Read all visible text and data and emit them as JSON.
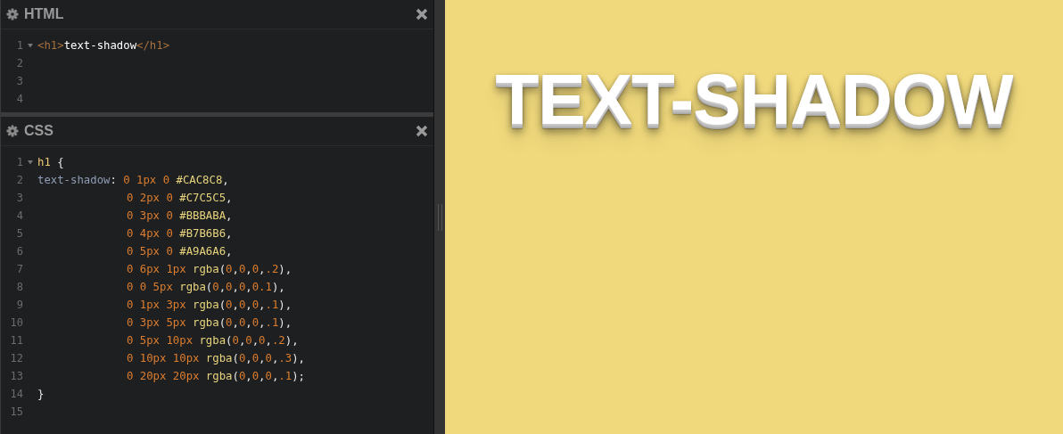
{
  "editors": [
    {
      "title": "HTML",
      "lines": [
        {
          "number": "1",
          "foldable": true,
          "indented": false,
          "tokens": [
            {
              "kind": "tag",
              "text": "<h1>"
            },
            {
              "kind": "text",
              "text": "text-shadow"
            },
            {
              "kind": "tag",
              "text": "</h1>"
            }
          ]
        },
        {
          "number": "2",
          "foldable": false
        },
        {
          "number": "3",
          "foldable": false
        },
        {
          "number": "4",
          "foldable": false
        }
      ]
    },
    {
      "title": "CSS",
      "lines": [
        {
          "number": "1",
          "foldable": true,
          "indented": false,
          "tokens": [
            {
              "kind": "selector",
              "text": "h1"
            },
            {
              "kind": "punct",
              "text": " {"
            }
          ]
        },
        {
          "number": "2",
          "foldable": false,
          "indented": false,
          "tokens": [
            {
              "kind": "property",
              "text": "text-shadow"
            },
            {
              "kind": "punct",
              "text": ": "
            },
            {
              "kind": "number",
              "text": "0 1px 0"
            },
            {
              "kind": "value",
              "text": " #CAC8C8"
            },
            {
              "kind": "punct",
              "text": ","
            }
          ]
        },
        {
          "number": "3",
          "foldable": false,
          "indented": true,
          "tokens": [
            {
              "kind": "number",
              "text": "0 2px 0"
            },
            {
              "kind": "value",
              "text": " #C7C5C5"
            },
            {
              "kind": "punct",
              "text": ","
            }
          ]
        },
        {
          "number": "4",
          "foldable": false,
          "indented": true,
          "tokens": [
            {
              "kind": "number",
              "text": "0 3px 0"
            },
            {
              "kind": "value",
              "text": " #BBBABA"
            },
            {
              "kind": "punct",
              "text": ","
            }
          ]
        },
        {
          "number": "5",
          "foldable": false,
          "indented": true,
          "tokens": [
            {
              "kind": "number",
              "text": "0 4px 0"
            },
            {
              "kind": "value",
              "text": " #B7B6B6"
            },
            {
              "kind": "punct",
              "text": ","
            }
          ]
        },
        {
          "number": "6",
          "foldable": false,
          "indented": true,
          "tokens": [
            {
              "kind": "number",
              "text": "0 5px 0"
            },
            {
              "kind": "value",
              "text": " #A9A6A6"
            },
            {
              "kind": "punct",
              "text": ","
            }
          ]
        },
        {
          "number": "7",
          "foldable": false,
          "indented": true,
          "tokens": [
            {
              "kind": "number",
              "text": "0 6px 1px"
            },
            {
              "kind": "value",
              "text": " rgba"
            },
            {
              "kind": "punct",
              "text": "("
            },
            {
              "kind": "number",
              "text": "0"
            },
            {
              "kind": "punct",
              "text": ","
            },
            {
              "kind": "number",
              "text": "0"
            },
            {
              "kind": "punct",
              "text": ","
            },
            {
              "kind": "number",
              "text": "0"
            },
            {
              "kind": "punct",
              "text": ","
            },
            {
              "kind": "number",
              "text": ".2"
            },
            {
              "kind": "punct",
              "text": "),"
            }
          ]
        },
        {
          "number": "8",
          "foldable": false,
          "indented": true,
          "tokens": [
            {
              "kind": "number",
              "text": "0 0 5px"
            },
            {
              "kind": "value",
              "text": " rgba"
            },
            {
              "kind": "punct",
              "text": "("
            },
            {
              "kind": "number",
              "text": "0"
            },
            {
              "kind": "punct",
              "text": ","
            },
            {
              "kind": "number",
              "text": "0"
            },
            {
              "kind": "punct",
              "text": ","
            },
            {
              "kind": "number",
              "text": "0"
            },
            {
              "kind": "punct",
              "text": ","
            },
            {
              "kind": "number",
              "text": "0.1"
            },
            {
              "kind": "punct",
              "text": "),"
            }
          ]
        },
        {
          "number": "9",
          "foldable": false,
          "indented": true,
          "tokens": [
            {
              "kind": "number",
              "text": "0 1px 3px"
            },
            {
              "kind": "value",
              "text": " rgba"
            },
            {
              "kind": "punct",
              "text": "("
            },
            {
              "kind": "number",
              "text": "0"
            },
            {
              "kind": "punct",
              "text": ","
            },
            {
              "kind": "number",
              "text": "0"
            },
            {
              "kind": "punct",
              "text": ","
            },
            {
              "kind": "number",
              "text": "0"
            },
            {
              "kind": "punct",
              "text": ","
            },
            {
              "kind": "number",
              "text": ".1"
            },
            {
              "kind": "punct",
              "text": "),"
            }
          ]
        },
        {
          "number": "10",
          "foldable": false,
          "indented": true,
          "tokens": [
            {
              "kind": "number",
              "text": "0 3px 5px"
            },
            {
              "kind": "value",
              "text": " rgba"
            },
            {
              "kind": "punct",
              "text": "("
            },
            {
              "kind": "number",
              "text": "0"
            },
            {
              "kind": "punct",
              "text": ","
            },
            {
              "kind": "number",
              "text": "0"
            },
            {
              "kind": "punct",
              "text": ","
            },
            {
              "kind": "number",
              "text": "0"
            },
            {
              "kind": "punct",
              "text": ","
            },
            {
              "kind": "number",
              "text": ".1"
            },
            {
              "kind": "punct",
              "text": "),"
            }
          ]
        },
        {
          "number": "11",
          "foldable": false,
          "indented": true,
          "tokens": [
            {
              "kind": "number",
              "text": "0 5px 10px"
            },
            {
              "kind": "value",
              "text": " rgba"
            },
            {
              "kind": "punct",
              "text": "("
            },
            {
              "kind": "number",
              "text": "0"
            },
            {
              "kind": "punct",
              "text": ","
            },
            {
              "kind": "number",
              "text": "0"
            },
            {
              "kind": "punct",
              "text": ","
            },
            {
              "kind": "number",
              "text": "0"
            },
            {
              "kind": "punct",
              "text": ","
            },
            {
              "kind": "number",
              "text": ".2"
            },
            {
              "kind": "punct",
              "text": "),"
            }
          ]
        },
        {
          "number": "12",
          "foldable": false,
          "indented": true,
          "tokens": [
            {
              "kind": "number",
              "text": "0 10px 10px"
            },
            {
              "kind": "value",
              "text": " rgba"
            },
            {
              "kind": "punct",
              "text": "("
            },
            {
              "kind": "number",
              "text": "0"
            },
            {
              "kind": "punct",
              "text": ","
            },
            {
              "kind": "number",
              "text": "0"
            },
            {
              "kind": "punct",
              "text": ","
            },
            {
              "kind": "number",
              "text": "0"
            },
            {
              "kind": "punct",
              "text": ","
            },
            {
              "kind": "number",
              "text": ".3"
            },
            {
              "kind": "punct",
              "text": "),"
            }
          ]
        },
        {
          "number": "13",
          "foldable": false,
          "indented": true,
          "tokens": [
            {
              "kind": "number",
              "text": "0 20px 20px"
            },
            {
              "kind": "value",
              "text": " rgba"
            },
            {
              "kind": "punct",
              "text": "("
            },
            {
              "kind": "number",
              "text": "0"
            },
            {
              "kind": "punct",
              "text": ","
            },
            {
              "kind": "number",
              "text": "0"
            },
            {
              "kind": "punct",
              "text": ","
            },
            {
              "kind": "number",
              "text": "0"
            },
            {
              "kind": "punct",
              "text": ","
            },
            {
              "kind": "number",
              "text": ".1"
            },
            {
              "kind": "punct",
              "text": ");"
            }
          ]
        },
        {
          "number": "14",
          "foldable": false,
          "indented": false,
          "tokens": [
            {
              "kind": "punct",
              "text": "}"
            }
          ]
        },
        {
          "number": "15",
          "foldable": false
        }
      ]
    }
  ],
  "preview": {
    "heading": "TEXT-SHADOW"
  }
}
